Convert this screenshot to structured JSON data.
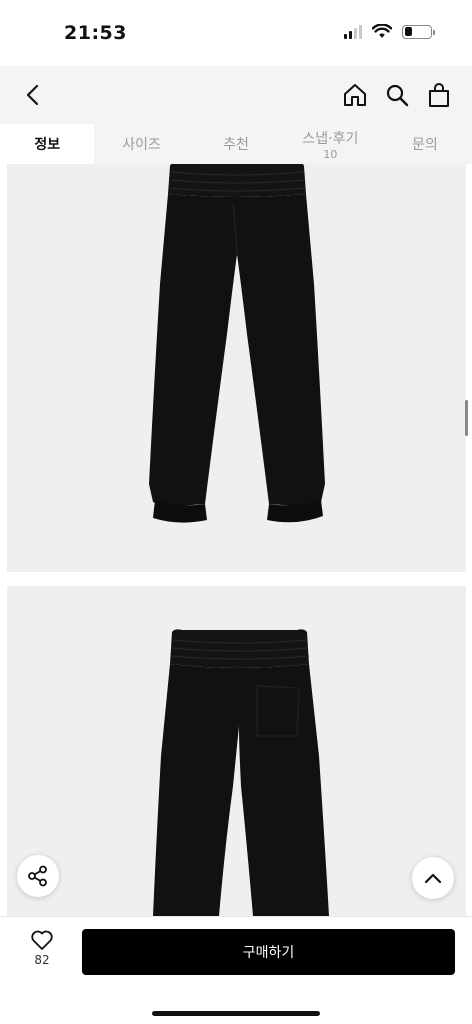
{
  "status_bar": {
    "time": "21:53",
    "icons": [
      "cellular-signal-icon",
      "wifi-icon",
      "battery-icon"
    ],
    "battery_level": 0.3
  },
  "header": {
    "back_icon": "chevron-left-icon",
    "actions": [
      "home-icon",
      "search-icon",
      "shopping-bag-icon"
    ]
  },
  "tabs": [
    {
      "label": "정보",
      "active": true
    },
    {
      "label": "사이즈"
    },
    {
      "label": "추천"
    },
    {
      "label": "스냅·후기",
      "count": "10"
    },
    {
      "label": "문의"
    }
  ],
  "floating": {
    "share_icon": "share-icon",
    "top_icon": "chevron-up-icon"
  },
  "bottom_bar": {
    "like_icon": "heart-icon",
    "like_count": "82",
    "buy_label": "구매하기"
  },
  "colors": {
    "accent": "#000000",
    "header_bg": "#f4f4f4",
    "image_bg": "#efefef"
  }
}
